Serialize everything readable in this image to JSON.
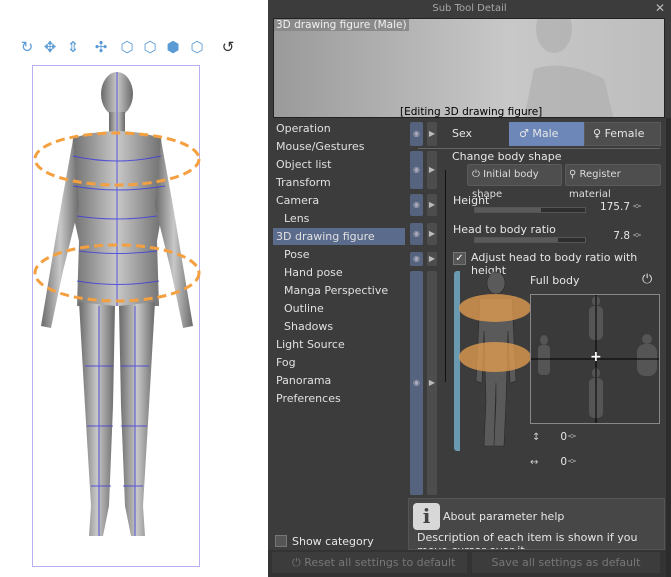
{
  "toolbar": {
    "icons": [
      "rotate-camera-icon",
      "pan-camera-icon",
      "zoom-camera-icon",
      "move-object-icon",
      "rotate-object-icon",
      "rotate-xy-icon",
      "rotate-plane-icon",
      "scale-object-icon",
      "snap-to-plane-icon"
    ]
  },
  "panel": {
    "title": "Sub Tool Detail",
    "close": "✕",
    "preview_name": "3D drawing figure (Male)",
    "preview_status": "[Editing 3D drawing figure]",
    "categories": [
      {
        "label": "Operation"
      },
      {
        "label": "Mouse/Gestures"
      },
      {
        "label": "Object list"
      },
      {
        "label": "Transform"
      },
      {
        "label": "Camera"
      },
      {
        "label": "Lens",
        "sub": true
      },
      {
        "label": "3D drawing figure",
        "selected": true
      },
      {
        "label": "Pose",
        "sub": true
      },
      {
        "label": "Hand pose",
        "sub": true
      },
      {
        "label": "Manga Perspective",
        "sub": true
      },
      {
        "label": "Outline",
        "sub": true
      },
      {
        "label": "Shadows",
        "sub": true
      },
      {
        "label": "Light Source"
      },
      {
        "label": "Fog"
      },
      {
        "label": "Panorama"
      },
      {
        "label": "Preferences"
      }
    ],
    "show_category": "Show category",
    "sex_label": "Sex",
    "male": "Male",
    "female": "Female",
    "change_body_shape": "Change body shape",
    "initial_body_shape": "Initial body shape",
    "register_material": "Register material",
    "height_label": "Height",
    "height_value": "175.7",
    "height_fraction": 0.6,
    "ratio_label": "Head to body ratio",
    "ratio_value": "7.8",
    "ratio_fraction": 0.75,
    "adjust_label": "Adjust head to body ratio with height",
    "adjust_checked": true,
    "full_body": "Full body",
    "vertical_value": "0",
    "horizontal_value": "0",
    "help_title": "About parameter help",
    "help_text": "Description of each item is shown if you move cursor over it",
    "reset_button": "Reset all settings to default",
    "save_button": "Save all settings as default",
    "accent": "#6d87b8"
  }
}
